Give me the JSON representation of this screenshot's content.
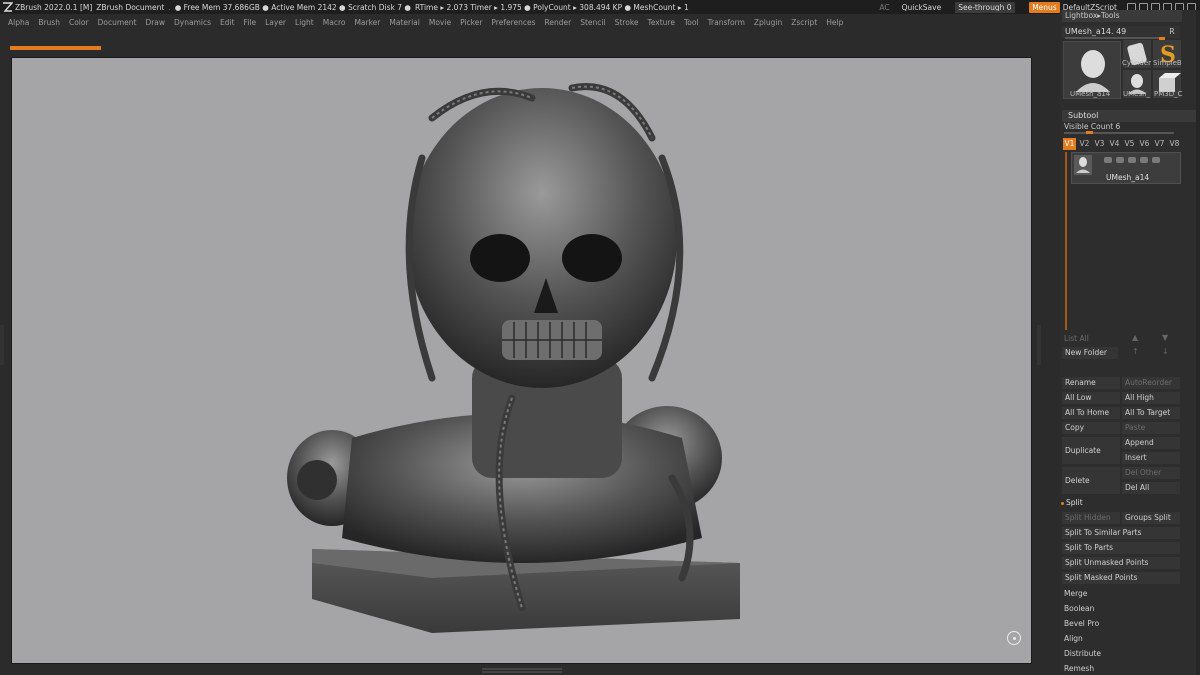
{
  "titlebar": {
    "app": "ZBrush 2022.0.1 [M]",
    "document": "ZBrush Document",
    "dot": ".",
    "stats": "● Free Mem 37.686GB ● Active Mem 2142 ● Scratch Disk 7 ●",
    "rtime": "RTime ▸ 2.073 Timer ▸ 1.975 ● PolyCount ▸ 308.494 KP ● MeshCount ▸ 1",
    "ac": "AC",
    "quicksave": "QuickSave",
    "seethrough": "See-through  0",
    "menus": "Menus",
    "script": "DefaultZScript"
  },
  "menubar": [
    "Alpha",
    "Brush",
    "Color",
    "Document",
    "Draw",
    "Dynamics",
    "Edit",
    "File",
    "Layer",
    "Light",
    "Macro",
    "Marker",
    "Material",
    "Movie",
    "Picker",
    "Preferences",
    "Render",
    "Stencil",
    "Stroke",
    "Texture",
    "Tool",
    "Transform",
    "Zplugin",
    "Zscript",
    "Help"
  ],
  "colors": {
    "accent": "#e37c1e",
    "canvas": "#a5a5a8",
    "panel": "#2d2d2d"
  },
  "tool": {
    "lightbox_label": "Lightbox▸Tools",
    "name": "UMesh_a14. 49",
    "r_label": "R",
    "thumbs": [
      {
        "label": "UMesh_a14"
      },
      {
        "label": "Cylinder"
      },
      {
        "label": "SimpleB"
      },
      {
        "label": "UMesh_"
      },
      {
        "label": "PM3D_C"
      }
    ]
  },
  "subtool": {
    "header": "Subtool",
    "visible_count": "Visible Count 6",
    "visible_value": 6,
    "tabs": [
      "V1",
      "V2",
      "V3",
      "V4",
      "V5",
      "V6",
      "V7",
      "V8"
    ],
    "active_tab": "V1",
    "item_name": "UMesh_a14",
    "list_all": "List All",
    "new_folder": "New Folder",
    "rename": "Rename",
    "auto_reorder": "AutoReorder",
    "all_low": "All Low",
    "all_high": "All High",
    "all_to_home": "All To Home",
    "all_to_target": "All To Target",
    "copy": "Copy",
    "paste": "Paste",
    "duplicate": "Duplicate",
    "append": "Append",
    "insert": "Insert",
    "delete": "Delete",
    "del_other": "Del Other",
    "del_all": "Del All",
    "split": "Split",
    "split_hidden": "Split Hidden",
    "groups_split": "Groups Split",
    "split_similar": "Split To Similar Parts",
    "split_parts": "Split To Parts",
    "split_unmasked": "Split Unmasked Points",
    "split_masked": "Split Masked Points",
    "merge": "Merge",
    "boolean": "Boolean",
    "bevel_pro": "Bevel Pro",
    "align": "Align",
    "distribute": "Distribute",
    "remesh": "Remesh"
  }
}
